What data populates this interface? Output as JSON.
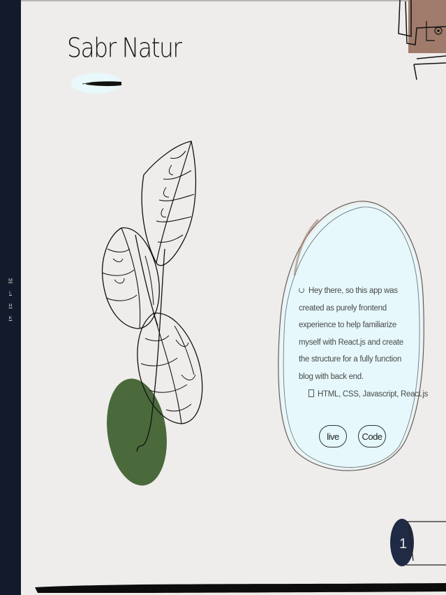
{
  "brand": {
    "title": "Sabr Natur"
  },
  "sidebar": {
    "items": [
      {
        "label": "M"
      },
      {
        "label": "L"
      },
      {
        "label": "H"
      },
      {
        "label": "K"
      }
    ]
  },
  "project": {
    "description": "Hey there, so this app was created as purely frontend experience to help familiarize myself with React.js and create the structure for a fully function blog with back end.",
    "tech_stack": "HTML, CSS, Javascript, React.js",
    "live_label": "live",
    "code_label": "Code"
  },
  "pagination": {
    "current": "1"
  },
  "colors": {
    "sidebar_bg": "#131a2c",
    "page_bg": "#efedeb",
    "card_bg": "#e6f8fb",
    "leaf_green": "#4a6a3c",
    "terracotta": "#a07b6c",
    "indicator_bg": "#1f2a44"
  }
}
